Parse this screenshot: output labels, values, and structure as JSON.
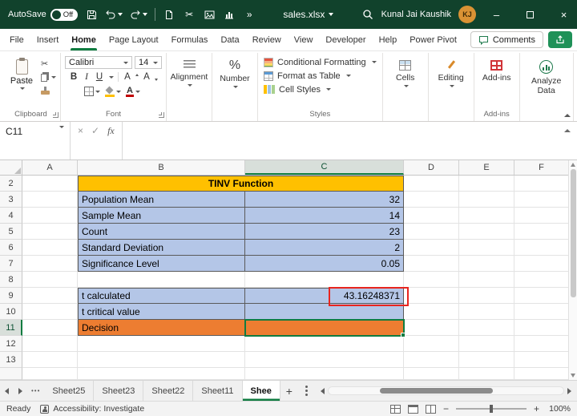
{
  "title_bar": {
    "autosave_label": "AutoSave",
    "autosave_state": "Off",
    "filename": "sales.xlsx",
    "user_name": "Kunal Jai Kaushik",
    "user_initials": "KJ"
  },
  "ribbon_tabs": {
    "items": [
      "File",
      "Insert",
      "Home",
      "Page Layout",
      "Formulas",
      "Data",
      "Review",
      "View",
      "Developer",
      "Help",
      "Power Pivot"
    ],
    "active": "Home",
    "comments_label": "Comments"
  },
  "ribbon": {
    "clipboard": {
      "paste_label": "Paste",
      "group_label": "Clipboard"
    },
    "font": {
      "font_name": "Calibri",
      "font_size": "14",
      "group_label": "Font"
    },
    "alignment": {
      "label": "Alignment"
    },
    "number": {
      "label": "Number"
    },
    "styles": {
      "conditional_formatting": "Conditional Formatting",
      "format_as_table": "Format as Table",
      "cell_styles": "Cell Styles",
      "group_label": "Styles"
    },
    "cells": {
      "label": "Cells"
    },
    "editing": {
      "label": "Editing"
    },
    "addins": {
      "button_label": "Add-ins",
      "group_label": "Add-ins"
    },
    "analyze": {
      "label": "Analyze Data"
    }
  },
  "formula_bar": {
    "name_box": "C11",
    "fx_label": "fx",
    "value": ""
  },
  "grid": {
    "column_headers": [
      "A",
      "B",
      "C",
      "D",
      "E",
      "F"
    ],
    "selected_column": "C",
    "selected_row": "11",
    "rows": [
      {
        "n": "2",
        "b": "TINV Function",
        "c": "",
        "style": "title",
        "block_start": true
      },
      {
        "n": "3",
        "b": "Population Mean",
        "c": "32",
        "style": "blue"
      },
      {
        "n": "4",
        "b": "Sample Mean",
        "c": "14",
        "style": "blue"
      },
      {
        "n": "5",
        "b": "Count",
        "c": "23",
        "style": "blue"
      },
      {
        "n": "6",
        "b": "Standard Deviation",
        "c": "2",
        "style": "blue"
      },
      {
        "n": "7",
        "b": "Significance Level",
        "c": "0.05",
        "style": "blue"
      },
      {
        "n": "8",
        "b": "",
        "c": "",
        "style": "none"
      },
      {
        "n": "9",
        "b": "t calculated",
        "c": "43.16248371",
        "style": "blue",
        "block_start": true,
        "annotation": "red-box"
      },
      {
        "n": "10",
        "b": "t critical value",
        "c": "",
        "style": "blue"
      },
      {
        "n": "11",
        "b": "Decision",
        "c": "",
        "style": "orange",
        "active_cell": true
      },
      {
        "n": "12",
        "b": "",
        "c": "",
        "style": "none"
      },
      {
        "n": "13",
        "b": "",
        "c": "",
        "style": "none"
      }
    ]
  },
  "sheet_tabs": {
    "tabs": [
      {
        "label": "Sheet25",
        "active": false
      },
      {
        "label": "Sheet23",
        "active": false
      },
      {
        "label": "Sheet22",
        "active": false
      },
      {
        "label": "Sheet11",
        "active": false
      },
      {
        "label": "Shee",
        "active": true
      }
    ]
  },
  "status_bar": {
    "ready_label": "Ready",
    "accessibility_label": "Accessibility: Investigate",
    "zoom_level": "100%"
  },
  "icons": {
    "minimize": "–",
    "close": "×",
    "overflow": "»",
    "cut": "✂",
    "cancel": "×",
    "check": "✓",
    "percent": "%",
    "bold": "B",
    "italic": "I",
    "underline": "U",
    "font_color": "A",
    "grow_font": "A",
    "shrink_font": "A",
    "hidden_sheets": "•••",
    "add_sheet": "+",
    "zoom_out": "−",
    "zoom_in": "+"
  },
  "colors": {
    "accent_green": "#107C41",
    "header_gold": "#FFC000",
    "cell_blue": "#B4C6E7",
    "cell_orange": "#ED7D31",
    "annotation_red": "#E8251F"
  }
}
